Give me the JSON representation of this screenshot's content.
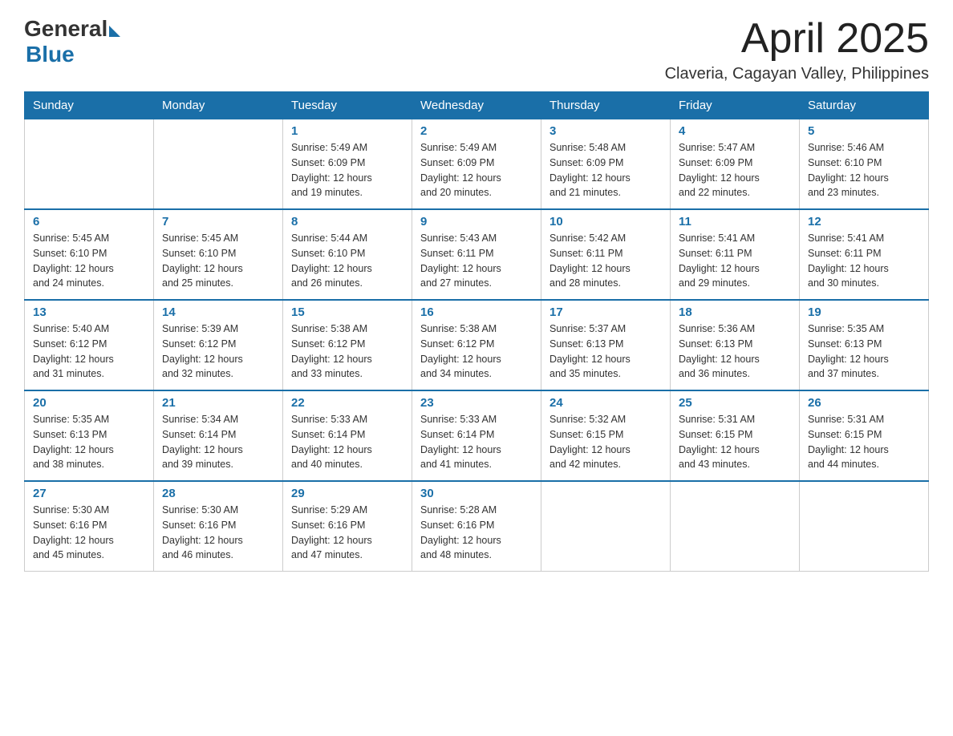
{
  "logo": {
    "general": "General",
    "blue": "Blue"
  },
  "title": "April 2025",
  "location": "Claveria, Cagayan Valley, Philippines",
  "weekdays": [
    "Sunday",
    "Monday",
    "Tuesday",
    "Wednesday",
    "Thursday",
    "Friday",
    "Saturday"
  ],
  "weeks": [
    [
      {
        "day": "",
        "info": ""
      },
      {
        "day": "",
        "info": ""
      },
      {
        "day": "1",
        "info": "Sunrise: 5:49 AM\nSunset: 6:09 PM\nDaylight: 12 hours\nand 19 minutes."
      },
      {
        "day": "2",
        "info": "Sunrise: 5:49 AM\nSunset: 6:09 PM\nDaylight: 12 hours\nand 20 minutes."
      },
      {
        "day": "3",
        "info": "Sunrise: 5:48 AM\nSunset: 6:09 PM\nDaylight: 12 hours\nand 21 minutes."
      },
      {
        "day": "4",
        "info": "Sunrise: 5:47 AM\nSunset: 6:09 PM\nDaylight: 12 hours\nand 22 minutes."
      },
      {
        "day": "5",
        "info": "Sunrise: 5:46 AM\nSunset: 6:10 PM\nDaylight: 12 hours\nand 23 minutes."
      }
    ],
    [
      {
        "day": "6",
        "info": "Sunrise: 5:45 AM\nSunset: 6:10 PM\nDaylight: 12 hours\nand 24 minutes."
      },
      {
        "day": "7",
        "info": "Sunrise: 5:45 AM\nSunset: 6:10 PM\nDaylight: 12 hours\nand 25 minutes."
      },
      {
        "day": "8",
        "info": "Sunrise: 5:44 AM\nSunset: 6:10 PM\nDaylight: 12 hours\nand 26 minutes."
      },
      {
        "day": "9",
        "info": "Sunrise: 5:43 AM\nSunset: 6:11 PM\nDaylight: 12 hours\nand 27 minutes."
      },
      {
        "day": "10",
        "info": "Sunrise: 5:42 AM\nSunset: 6:11 PM\nDaylight: 12 hours\nand 28 minutes."
      },
      {
        "day": "11",
        "info": "Sunrise: 5:41 AM\nSunset: 6:11 PM\nDaylight: 12 hours\nand 29 minutes."
      },
      {
        "day": "12",
        "info": "Sunrise: 5:41 AM\nSunset: 6:11 PM\nDaylight: 12 hours\nand 30 minutes."
      }
    ],
    [
      {
        "day": "13",
        "info": "Sunrise: 5:40 AM\nSunset: 6:12 PM\nDaylight: 12 hours\nand 31 minutes."
      },
      {
        "day": "14",
        "info": "Sunrise: 5:39 AM\nSunset: 6:12 PM\nDaylight: 12 hours\nand 32 minutes."
      },
      {
        "day": "15",
        "info": "Sunrise: 5:38 AM\nSunset: 6:12 PM\nDaylight: 12 hours\nand 33 minutes."
      },
      {
        "day": "16",
        "info": "Sunrise: 5:38 AM\nSunset: 6:12 PM\nDaylight: 12 hours\nand 34 minutes."
      },
      {
        "day": "17",
        "info": "Sunrise: 5:37 AM\nSunset: 6:13 PM\nDaylight: 12 hours\nand 35 minutes."
      },
      {
        "day": "18",
        "info": "Sunrise: 5:36 AM\nSunset: 6:13 PM\nDaylight: 12 hours\nand 36 minutes."
      },
      {
        "day": "19",
        "info": "Sunrise: 5:35 AM\nSunset: 6:13 PM\nDaylight: 12 hours\nand 37 minutes."
      }
    ],
    [
      {
        "day": "20",
        "info": "Sunrise: 5:35 AM\nSunset: 6:13 PM\nDaylight: 12 hours\nand 38 minutes."
      },
      {
        "day": "21",
        "info": "Sunrise: 5:34 AM\nSunset: 6:14 PM\nDaylight: 12 hours\nand 39 minutes."
      },
      {
        "day": "22",
        "info": "Sunrise: 5:33 AM\nSunset: 6:14 PM\nDaylight: 12 hours\nand 40 minutes."
      },
      {
        "day": "23",
        "info": "Sunrise: 5:33 AM\nSunset: 6:14 PM\nDaylight: 12 hours\nand 41 minutes."
      },
      {
        "day": "24",
        "info": "Sunrise: 5:32 AM\nSunset: 6:15 PM\nDaylight: 12 hours\nand 42 minutes."
      },
      {
        "day": "25",
        "info": "Sunrise: 5:31 AM\nSunset: 6:15 PM\nDaylight: 12 hours\nand 43 minutes."
      },
      {
        "day": "26",
        "info": "Sunrise: 5:31 AM\nSunset: 6:15 PM\nDaylight: 12 hours\nand 44 minutes."
      }
    ],
    [
      {
        "day": "27",
        "info": "Sunrise: 5:30 AM\nSunset: 6:16 PM\nDaylight: 12 hours\nand 45 minutes."
      },
      {
        "day": "28",
        "info": "Sunrise: 5:30 AM\nSunset: 6:16 PM\nDaylight: 12 hours\nand 46 minutes."
      },
      {
        "day": "29",
        "info": "Sunrise: 5:29 AM\nSunset: 6:16 PM\nDaylight: 12 hours\nand 47 minutes."
      },
      {
        "day": "30",
        "info": "Sunrise: 5:28 AM\nSunset: 6:16 PM\nDaylight: 12 hours\nand 48 minutes."
      },
      {
        "day": "",
        "info": ""
      },
      {
        "day": "",
        "info": ""
      },
      {
        "day": "",
        "info": ""
      }
    ]
  ]
}
